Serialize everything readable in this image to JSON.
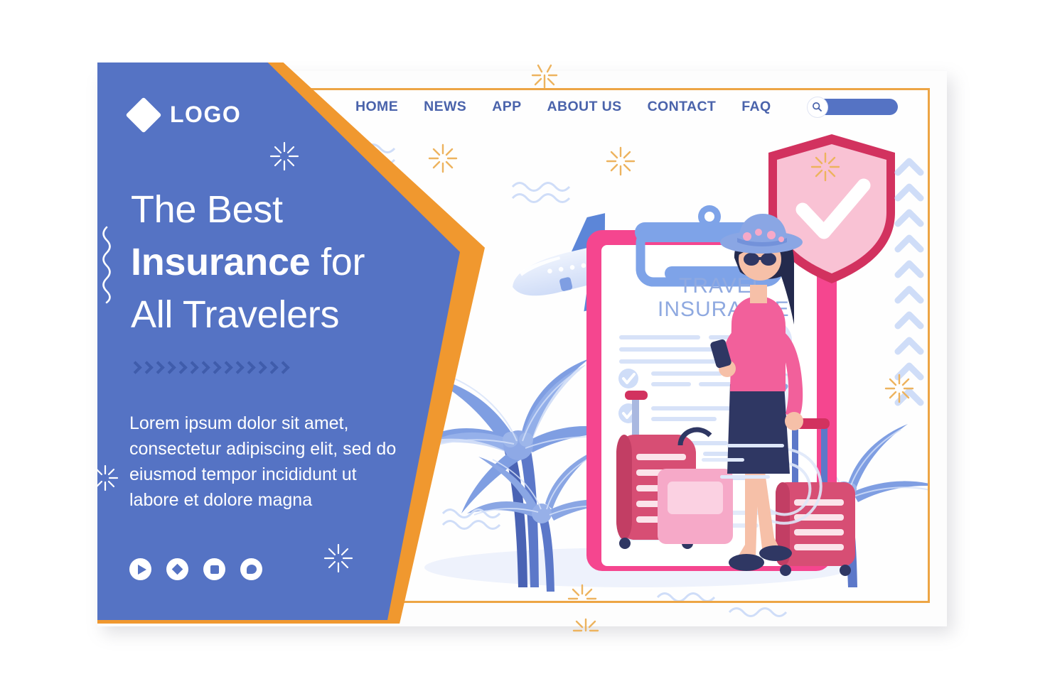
{
  "brand": {
    "logo_text": "LOGO",
    "logo_icon": "diamond-icon",
    "panel_color": "#5573c4",
    "accent_orange": "#f0982f",
    "accent_pink": "#f5468f",
    "text_blue": "#4a63ab"
  },
  "nav": {
    "items": [
      {
        "label": "HOME"
      },
      {
        "label": "NEWS"
      },
      {
        "label": "APP"
      },
      {
        "label": "ABOUT US"
      },
      {
        "label": "CONTACT"
      },
      {
        "label": "FAQ"
      }
    ],
    "search": {
      "icon": "search-icon",
      "value": "",
      "placeholder": ""
    }
  },
  "hero": {
    "headline_line1_normal": "The Best",
    "headline_line2_bold": "Insurance",
    "headline_line2_normal": " for",
    "headline_line3_normal": "All Travelers",
    "paragraph": "Lorem ipsum dolor sit amet, consectetur adipiscing elit, sed do eiusmod tempor incididunt ut labore et dolore magna"
  },
  "social_icons": [
    {
      "name": "play-icon"
    },
    {
      "name": "diamond-icon"
    },
    {
      "name": "square-icon"
    },
    {
      "name": "chat-icon"
    }
  ],
  "illustration": {
    "clipboard_title_line1": "TRAVEL",
    "clipboard_title_line2": "INSURANCE",
    "clipboard_border_color": "#f5468f",
    "clip_color": "#7ea3e8",
    "paper_color": "#ffffff",
    "shield_fill": "#f9c2d4",
    "shield_border": "#d2325f",
    "shield_check": "#ffffff",
    "checklist_items": 4,
    "badges": [
      "user-avatar-icon",
      "shield-check-icon"
    ],
    "character": {
      "hat_color": "#8aa6e4",
      "top_color": "#f2609b",
      "skirt_color": "#2f3763",
      "hair_color": "#242a4d",
      "holds": "smartphone"
    },
    "luggage": [
      {
        "name": "large-suitcase",
        "color": "#e04a72"
      },
      {
        "name": "handbag",
        "color": "#f6a9c8"
      },
      {
        "name": "rolling-suitcase",
        "color": "#e04a72"
      }
    ],
    "scenery": [
      "airplane-icon",
      "palm-tree-left",
      "palm-tree-right"
    ],
    "decorations": [
      "sparkle",
      "wave-lines",
      "chevron-column"
    ]
  }
}
